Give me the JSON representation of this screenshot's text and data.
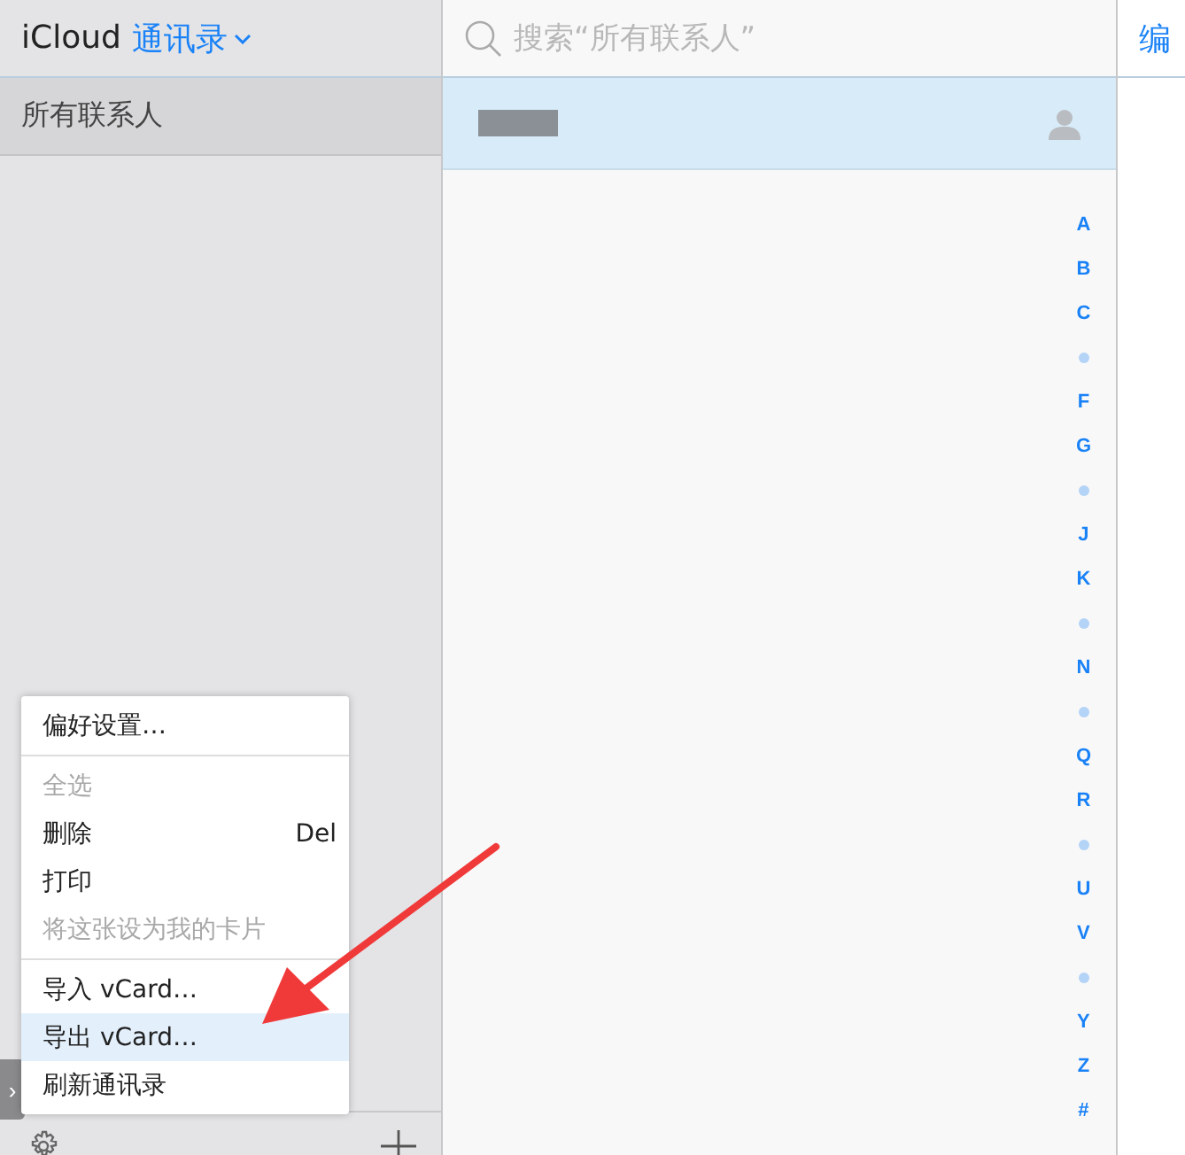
{
  "sidebar": {
    "app": "iCloud",
    "title": "通讯录",
    "groups": [
      {
        "label": "所有联系人",
        "selected": true
      }
    ]
  },
  "search": {
    "placeholder": "搜索“所有联系人”"
  },
  "contacts": [
    {
      "selected": true
    }
  ],
  "index": [
    {
      "kind": "letter",
      "label": "A"
    },
    {
      "kind": "letter",
      "label": "B"
    },
    {
      "kind": "letter",
      "label": "C"
    },
    {
      "kind": "dot"
    },
    {
      "kind": "letter",
      "label": "F"
    },
    {
      "kind": "letter",
      "label": "G"
    },
    {
      "kind": "dot"
    },
    {
      "kind": "letter",
      "label": "J"
    },
    {
      "kind": "letter",
      "label": "K"
    },
    {
      "kind": "dot"
    },
    {
      "kind": "letter",
      "label": "N"
    },
    {
      "kind": "dot"
    },
    {
      "kind": "letter",
      "label": "Q"
    },
    {
      "kind": "letter",
      "label": "R"
    },
    {
      "kind": "dot"
    },
    {
      "kind": "letter",
      "label": "U"
    },
    {
      "kind": "letter",
      "label": "V"
    },
    {
      "kind": "dot"
    },
    {
      "kind": "letter",
      "label": "Y"
    },
    {
      "kind": "letter",
      "label": "Z"
    },
    {
      "kind": "letter",
      "label": "#"
    }
  ],
  "edit_button": "编",
  "expand_tab": "›",
  "menu": {
    "items": [
      {
        "kind": "item",
        "label": "偏好设置…",
        "disabled": false,
        "selected": false
      },
      {
        "kind": "separator"
      },
      {
        "kind": "item",
        "label": "全选",
        "disabled": true,
        "selected": false
      },
      {
        "kind": "item",
        "label": "删除",
        "shortcut": "Del",
        "disabled": false,
        "selected": false
      },
      {
        "kind": "item",
        "label": "打印",
        "disabled": false,
        "selected": false
      },
      {
        "kind": "item",
        "label": "将这张设为我的卡片",
        "disabled": true,
        "selected": false
      },
      {
        "kind": "separator"
      },
      {
        "kind": "item",
        "label": "导入 vCard…",
        "disabled": false,
        "selected": false
      },
      {
        "kind": "item",
        "label": "导出 vCard…",
        "disabled": false,
        "selected": true
      },
      {
        "kind": "item",
        "label": "刷新通讯录",
        "disabled": false,
        "selected": false
      }
    ]
  }
}
